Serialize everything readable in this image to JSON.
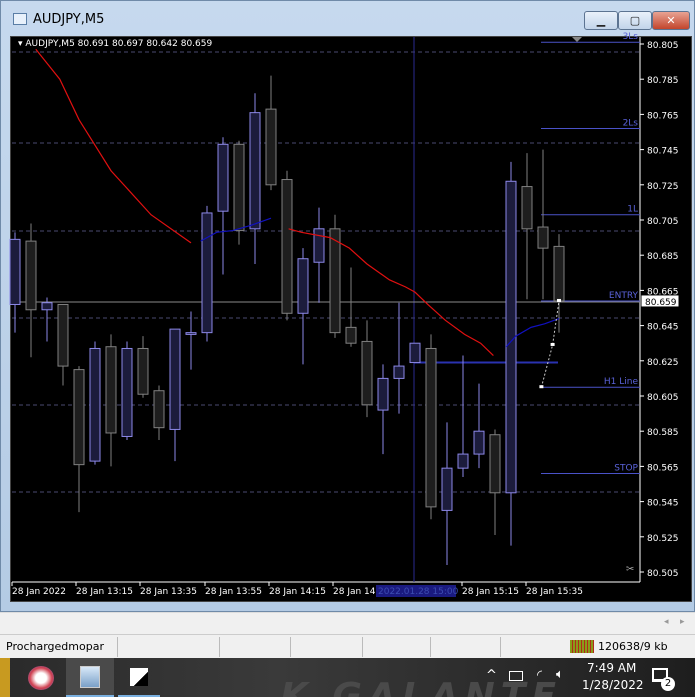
{
  "window": {
    "title": "AUDJPY,M5",
    "buttons": {
      "minimize": "▁",
      "maximize": "▢",
      "close": "✕"
    }
  },
  "chart": {
    "header": "AUDJPY,M5  80.691 80.697 80.642 80.659",
    "symbol": "AUDJPY,M5",
    "colors": {
      "bull_border": "#8c88e8",
      "bear_border": "#808080",
      "bull_fill": "#1c1c3c",
      "bear_fill": "#1e1e1e",
      "ma_red": "#e01010",
      "ma_blue": "#1010c0",
      "level_line": "#4a52c8",
      "grid": "#4a4a70"
    },
    "price_ticks": [
      "80.805",
      "80.785",
      "80.765",
      "80.745",
      "80.725",
      "80.705",
      "80.685",
      "80.665",
      "80.645",
      "80.625",
      "80.605",
      "80.585",
      "80.565",
      "80.545",
      "80.525",
      "80.505"
    ],
    "current_price": "80.659",
    "time_labels": [
      "28 Jan 2022",
      "28 Jan 13:15",
      "28 Jan 13:35",
      "28 Jan 13:55",
      "28 Jan 14:15",
      "28 Jan 14:",
      "28 Jan 15:15",
      "28 Jan 15:35"
    ],
    "crosshair_time": "2022.01.28 15:00",
    "levels": [
      {
        "label": "3Ls",
        "price": 80.806
      },
      {
        "label": "2Ls",
        "price": 80.757
      },
      {
        "label": "1L",
        "price": 80.708
      },
      {
        "label": "ENTRY",
        "price": 80.659
      },
      {
        "label": "H1 Line",
        "price": 80.61
      },
      {
        "label": "STOP",
        "price": 80.561
      }
    ],
    "h1_segment_price": 80.624
  },
  "chart_data": {
    "type": "candlestick",
    "title": "AUDJPY,M5",
    "ylim": [
      80.505,
      80.805
    ],
    "ohlc": [
      [
        80.657,
        80.698,
        80.641,
        80.694
      ],
      [
        80.693,
        80.703,
        80.627,
        80.654
      ],
      [
        80.654,
        80.661,
        80.636,
        80.658
      ],
      [
        80.657,
        80.657,
        80.611,
        80.622
      ],
      [
        80.62,
        80.622,
        80.539,
        80.566
      ],
      [
        80.568,
        80.636,
        80.566,
        80.632
      ],
      [
        80.633,
        80.64,
        80.565,
        80.584
      ],
      [
        80.582,
        80.636,
        80.58,
        80.632
      ],
      [
        80.632,
        80.639,
        80.604,
        80.606
      ],
      [
        80.608,
        80.611,
        80.58,
        80.587
      ],
      [
        80.586,
        80.643,
        80.568,
        80.643
      ],
      [
        80.64,
        80.653,
        80.62,
        80.641
      ],
      [
        80.641,
        80.713,
        80.636,
        80.709
      ],
      [
        80.71,
        80.752,
        80.674,
        80.748
      ],
      [
        80.748,
        80.75,
        80.691,
        80.699
      ],
      [
        80.7,
        80.777,
        80.68,
        80.766
      ],
      [
        80.768,
        80.787,
        80.722,
        80.725
      ],
      [
        80.728,
        80.733,
        80.648,
        80.652
      ],
      [
        80.652,
        80.689,
        80.623,
        80.683
      ],
      [
        80.681,
        80.712,
        80.658,
        80.7
      ],
      [
        80.7,
        80.708,
        80.638,
        80.641
      ],
      [
        80.644,
        80.678,
        80.633,
        80.635
      ],
      [
        80.636,
        80.648,
        80.593,
        80.6
      ],
      [
        80.597,
        80.623,
        80.572,
        80.615
      ],
      [
        80.615,
        80.658,
        80.595,
        80.622
      ],
      [
        80.624,
        80.635,
        80.624,
        80.635
      ],
      [
        80.632,
        80.64,
        80.535,
        80.542
      ],
      [
        80.54,
        80.59,
        80.509,
        80.564
      ],
      [
        80.564,
        80.628,
        80.559,
        80.572
      ],
      [
        80.572,
        80.612,
        80.564,
        80.585
      ],
      [
        80.583,
        80.586,
        80.526,
        80.55
      ],
      [
        80.55,
        80.738,
        80.52,
        80.727
      ],
      [
        80.724,
        80.743,
        80.66,
        80.7
      ],
      [
        80.701,
        80.745,
        80.66,
        80.689
      ],
      [
        80.69,
        80.697,
        80.641,
        80.659
      ]
    ],
    "ma_red": [
      [
        [
          1.3,
          80.802
        ],
        [
          2.8,
          80.785
        ],
        [
          4,
          80.762
        ],
        [
          6,
          80.733
        ],
        [
          8.5,
          80.708
        ],
        [
          11,
          80.692
        ]
      ],
      [
        [
          17.1,
          80.7
        ],
        [
          17.9,
          80.698
        ],
        [
          19.7,
          80.695
        ],
        [
          20.9,
          80.689
        ],
        [
          22,
          80.68
        ],
        [
          23.4,
          80.671
        ],
        [
          24.4,
          80.667
        ],
        [
          25,
          80.664
        ],
        [
          25.8,
          80.657
        ],
        [
          26.9,
          80.648
        ],
        [
          28.1,
          80.64
        ],
        [
          29.1,
          80.635
        ],
        [
          29.9,
          80.628
        ]
      ]
    ],
    "ma_blue": [
      [
        [
          11.6,
          80.693
        ],
        [
          12.6,
          80.698
        ],
        [
          13.6,
          80.699
        ],
        [
          14.75,
          80.702
        ],
        [
          16,
          80.706
        ]
      ],
      [
        [
          30.7,
          80.633
        ],
        [
          31.3,
          80.639
        ],
        [
          32.25,
          80.644
        ],
        [
          33.1,
          80.646
        ],
        [
          34,
          80.649
        ]
      ]
    ],
    "trade_path": [
      [
        32.9,
        80.61
      ],
      [
        33.6,
        80.634
      ],
      [
        34,
        80.659
      ]
    ]
  },
  "hscroll": {
    "left": "◂",
    "right": "▸"
  },
  "status": {
    "user": "Prochargedmopar",
    "traffic": "120638/9 kb"
  },
  "taskbar": {
    "watermark": "K GALANTE",
    "tray_chevron": "^",
    "time": "7:49 AM",
    "date": "1/28/2022",
    "notifications": "2"
  }
}
